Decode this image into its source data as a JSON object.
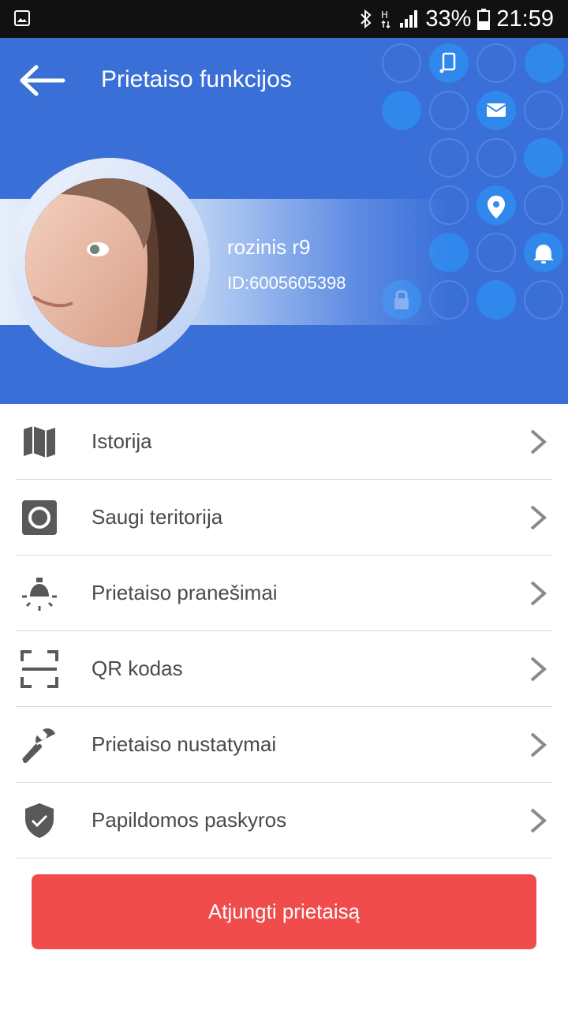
{
  "status_bar": {
    "battery_percent": "33%",
    "time": "21:59",
    "icons": [
      "gallery-icon",
      "bluetooth-icon",
      "network-h-icon",
      "signal-icon",
      "battery-icon"
    ]
  },
  "header": {
    "title": "Prietaiso funkcijos",
    "device_name": "rozinis r9",
    "device_id": "ID:6005605398",
    "background_color": "#3a6fd8",
    "decor_icons": [
      "cast-icon",
      "mail-icon",
      "location-pin-icon",
      "alarm-bell-icon",
      "lock-icon"
    ]
  },
  "menu": {
    "items": [
      {
        "label": "Istorija",
        "icon": "map-icon"
      },
      {
        "label": "Saugi teritorija",
        "icon": "safe-zone-icon"
      },
      {
        "label": "Prietaiso pranešimai",
        "icon": "bulb-notification-icon"
      },
      {
        "label": "QR kodas",
        "icon": "qr-scan-icon"
      },
      {
        "label": "Prietaiso nustatymai",
        "icon": "wrench-icon"
      },
      {
        "label": "Papildomos paskyros",
        "icon": "shield-check-icon"
      }
    ]
  },
  "disconnect_button": {
    "label": "Atjungti prietaisą",
    "color": "#f04c4c"
  }
}
